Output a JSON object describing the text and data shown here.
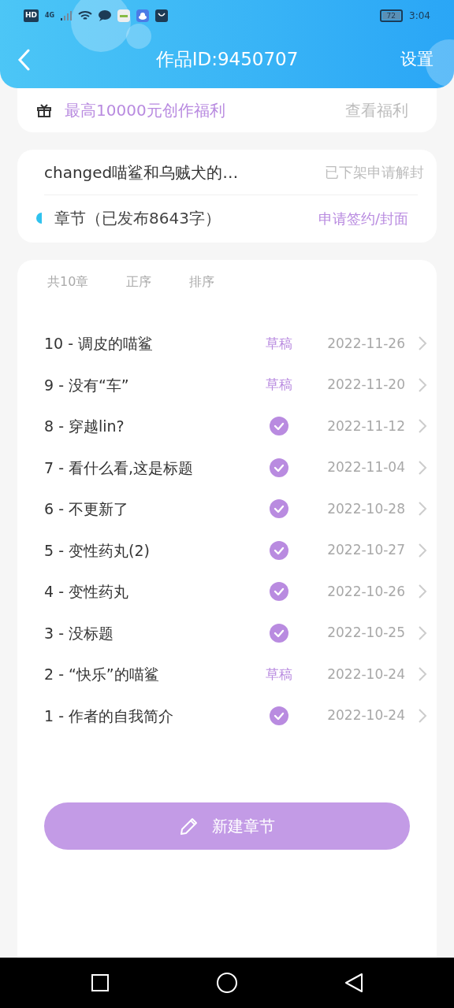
{
  "status_bar": {
    "hd": "HD",
    "network": "4G",
    "battery": "72",
    "time": "3:04"
  },
  "header": {
    "title": "作品ID:9450707",
    "action": "设置"
  },
  "benefit": {
    "text": "最高10000元创作福利",
    "link": "查看福利"
  },
  "work": {
    "title": "changed喵鲨和乌贼犬的…",
    "status": "已下架申请解封",
    "chapters_label": "章节（已发布8643字）",
    "apply": "申请签约/封面"
  },
  "list_header": {
    "count": "共10章",
    "order": "正序",
    "sort": "排序"
  },
  "chapters": [
    {
      "title": "10 - 调皮的喵鲨",
      "kind": "draft",
      "status_label": "草稿",
      "date": "2022-11-26"
    },
    {
      "title": "9 - 没有“车”",
      "kind": "draft",
      "status_label": "草稿",
      "date": "2022-11-20"
    },
    {
      "title": "8 - 穿越lin?",
      "kind": "published",
      "date": "2022-11-12"
    },
    {
      "title": "7 - 看什么看,这是标题",
      "kind": "published",
      "date": "2022-11-04"
    },
    {
      "title": "6 - 不更新了",
      "kind": "published",
      "date": "2022-10-28"
    },
    {
      "title": "5 - 变性药丸(2)",
      "kind": "published",
      "date": "2022-10-27"
    },
    {
      "title": "4 - 变性药丸",
      "kind": "published",
      "date": "2022-10-26"
    },
    {
      "title": "3 - 没标题",
      "kind": "published",
      "date": "2022-10-25"
    },
    {
      "title": "2 - “快乐”的喵鲨",
      "kind": "draft",
      "status_label": "草稿",
      "date": "2022-10-24"
    },
    {
      "title": "1 - 作者的自我简介",
      "kind": "published",
      "date": "2022-10-24"
    }
  ],
  "new_chapter_button": "新建章节"
}
